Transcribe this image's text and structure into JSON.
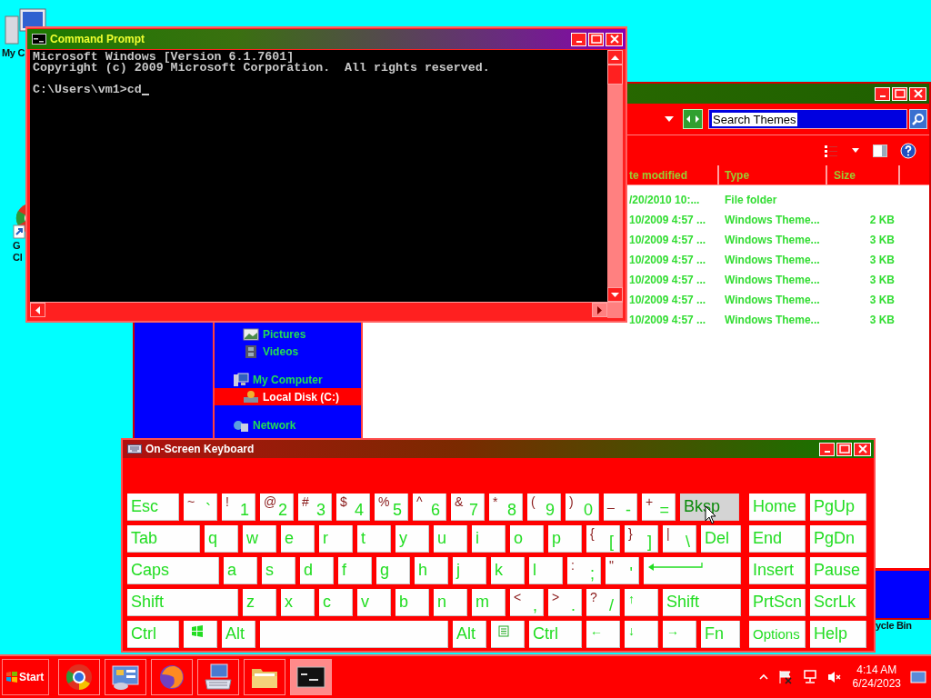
{
  "desktop_icons": [
    {
      "kind": "computer",
      "label_lines": [
        "My C"
      ]
    },
    {
      "kind": "browser",
      "label_lines": [
        "G",
        "Cl"
      ]
    },
    {
      "kind": "recycle_bin",
      "label_lines": [
        "ycle Bin"
      ]
    }
  ],
  "explorer": {
    "search": {
      "value": "Search Themes",
      "text_selected": true
    },
    "columns": [
      "te modified",
      "Type",
      "Size"
    ],
    "rows": [
      {
        "date": "/20/2010 10:...",
        "type": "File folder"
      },
      {
        "date": "10/2009 4:57 ...",
        "type": "Windows Theme...",
        "size": "2 KB"
      },
      {
        "date": "10/2009 4:57 ...",
        "type": "Windows Theme...",
        "size": "3 KB"
      },
      {
        "date": "10/2009 4:57 ...",
        "type": "Windows Theme...",
        "size": "3 KB"
      },
      {
        "date": "10/2009 4:57 ...",
        "type": "Windows Theme...",
        "size": "3 KB"
      },
      {
        "date": "10/2009 4:57 ...",
        "type": "Windows Theme...",
        "size": "3 KB"
      },
      {
        "date": "10/2009 4:57 ...",
        "type": "Windows Theme...",
        "size": "3 KB"
      }
    ],
    "nav": [
      {
        "children": [
          {
            "label": "Pictures",
            "kind": "pictures",
            "selected": false
          },
          {
            "label": "Videos",
            "kind": "videos",
            "selected": false
          }
        ]
      },
      {
        "label": "My Computer",
        "kind": "computer",
        "selected": false,
        "children": [
          {
            "label": "Local Disk (C:)",
            "kind": "disk",
            "selected": true
          }
        ]
      },
      {
        "label": "Network",
        "kind": "network",
        "selected": false
      }
    ]
  },
  "command_prompt": {
    "title": "Command Prompt",
    "lines": [
      "Microsoft Windows [Version 6.1.7601]",
      "Copyright (c) 2009 Microsoft Corporation.  All rights reserved."
    ],
    "prompt": "C:\\Users\\vm1>cd"
  },
  "keyboard": {
    "title": "On-Screen Keyboard",
    "main_rows": [
      [
        {
          "kind": "word",
          "label": "Esc",
          "hovered": false
        },
        {
          "kind": "dual",
          "shift": "~",
          "base": "`",
          "hovered": false
        },
        {
          "kind": "dual",
          "shift": "!",
          "base": "1",
          "hovered": false
        },
        {
          "kind": "dual",
          "shift": "@",
          "base": "2",
          "hovered": false
        },
        {
          "kind": "dual",
          "shift": "#",
          "base": "3",
          "hovered": false
        },
        {
          "kind": "dual",
          "shift": "$",
          "base": "4",
          "hovered": false
        },
        {
          "kind": "dual",
          "shift": "%",
          "base": "5",
          "hovered": false
        },
        {
          "kind": "dual",
          "shift": "^",
          "base": "6",
          "hovered": false
        },
        {
          "kind": "dual",
          "shift": "&",
          "base": "7",
          "hovered": false
        },
        {
          "kind": "dual",
          "shift": "*",
          "base": "8",
          "hovered": false
        },
        {
          "kind": "dual",
          "shift": "(",
          "base": "9",
          "hovered": false
        },
        {
          "kind": "dual",
          "shift": ")",
          "base": "0",
          "hovered": false
        },
        {
          "kind": "dual",
          "shift": "_",
          "base": "-",
          "hovered": false
        },
        {
          "kind": "dual",
          "shift": "+",
          "base": "=",
          "hovered": false
        },
        {
          "kind": "word",
          "label": "Bksp",
          "hovered": true
        }
      ],
      [
        {
          "kind": "word",
          "label": "Tab",
          "hovered": false
        },
        {
          "kind": "word",
          "label": "q",
          "hovered": false
        },
        {
          "kind": "word",
          "label": "w",
          "hovered": false
        },
        {
          "kind": "word",
          "label": "e",
          "hovered": false
        },
        {
          "kind": "word",
          "label": "r",
          "hovered": false
        },
        {
          "kind": "word",
          "label": "t",
          "hovered": false
        },
        {
          "kind": "word",
          "label": "y",
          "hovered": false
        },
        {
          "kind": "word",
          "label": "u",
          "hovered": false
        },
        {
          "kind": "word",
          "label": "i",
          "hovered": false
        },
        {
          "kind": "word",
          "label": "o",
          "hovered": false
        },
        {
          "kind": "word",
          "label": "p",
          "hovered": false
        },
        {
          "kind": "dual",
          "shift": "{",
          "base": "[",
          "hovered": false
        },
        {
          "kind": "dual",
          "shift": "}",
          "base": "]",
          "hovered": false
        },
        {
          "kind": "dual",
          "shift": "|",
          "base": "\\",
          "hovered": false
        },
        {
          "kind": "word",
          "label": "Del",
          "hovered": false
        }
      ],
      [
        {
          "kind": "word",
          "label": "Caps",
          "hovered": false
        },
        {
          "kind": "word",
          "label": "a",
          "hovered": false
        },
        {
          "kind": "word",
          "label": "s",
          "hovered": false
        },
        {
          "kind": "word",
          "label": "d",
          "hovered": false
        },
        {
          "kind": "word",
          "label": "f",
          "hovered": false
        },
        {
          "kind": "word",
          "label": "g",
          "hovered": false
        },
        {
          "kind": "word",
          "label": "h",
          "hovered": false
        },
        {
          "kind": "word",
          "label": "j",
          "hovered": false
        },
        {
          "kind": "word",
          "label": "k",
          "hovered": false
        },
        {
          "kind": "word",
          "label": "l",
          "hovered": false
        },
        {
          "kind": "dual",
          "shift": ":",
          "base": ";",
          "hovered": false
        },
        {
          "kind": "dual",
          "shift": "\"",
          "base": "'",
          "hovered": false
        },
        {
          "kind": "enter",
          "hovered": false
        }
      ],
      [
        {
          "kind": "word",
          "label": "Shift",
          "hovered": false
        },
        {
          "kind": "word",
          "label": "z",
          "hovered": false
        },
        {
          "kind": "word",
          "label": "x",
          "hovered": false
        },
        {
          "kind": "word",
          "label": "c",
          "hovered": false
        },
        {
          "kind": "word",
          "label": "v",
          "hovered": false
        },
        {
          "kind": "word",
          "label": "b",
          "hovered": false
        },
        {
          "kind": "word",
          "label": "n",
          "hovered": false
        },
        {
          "kind": "word",
          "label": "m",
          "hovered": false
        },
        {
          "kind": "dual",
          "shift": "<",
          "base": ",",
          "hovered": false
        },
        {
          "kind": "dual",
          "shift": ">",
          "base": ".",
          "hovered": false
        },
        {
          "kind": "dual",
          "shift": "?",
          "base": "/",
          "hovered": false
        },
        {
          "kind": "arrow",
          "label": "↑",
          "hovered": false
        },
        {
          "kind": "word",
          "label": "Shift",
          "hovered": false
        }
      ],
      [
        {
          "kind": "word",
          "label": "Ctrl",
          "hovered": false
        },
        {
          "kind": "windows",
          "hovered": false
        },
        {
          "kind": "word",
          "label": "Alt",
          "hovered": false
        },
        {
          "kind": "space",
          "hovered": false
        },
        {
          "kind": "word",
          "label": "Alt",
          "hovered": false
        },
        {
          "kind": "menu",
          "hovered": false
        },
        {
          "kind": "word",
          "label": "Ctrl",
          "hovered": false
        },
        {
          "kind": "arrow",
          "label": "←",
          "hovered": false
        },
        {
          "kind": "arrow",
          "label": "↓",
          "hovered": false
        },
        {
          "kind": "arrow",
          "label": "→",
          "hovered": false
        },
        {
          "kind": "word",
          "label": "Fn",
          "hovered": false
        }
      ]
    ],
    "nav_rows": [
      [
        {
          "kind": "word",
          "label": "Home",
          "hovered": false
        },
        {
          "kind": "word",
          "label": "PgUp",
          "hovered": false
        }
      ],
      [
        {
          "kind": "word",
          "label": "End",
          "hovered": false
        },
        {
          "kind": "word",
          "label": "PgDn",
          "hovered": false
        }
      ],
      [
        {
          "kind": "word",
          "label": "Insert",
          "hovered": false
        },
        {
          "kind": "word",
          "label": "Pause",
          "hovered": false
        }
      ],
      [
        {
          "kind": "word",
          "label": "PrtScn",
          "hovered": false
        },
        {
          "kind": "word",
          "label": "ScrLk",
          "hovered": false
        }
      ],
      [
        {
          "kind": "small",
          "label": "Options",
          "hovered": false
        },
        {
          "kind": "word",
          "label": "Help",
          "hovered": false
        }
      ]
    ]
  },
  "taskbar": {
    "start": "Start",
    "items": [
      {
        "kind": "browser",
        "selected": false
      },
      {
        "kind": "control_panel",
        "selected": false
      },
      {
        "kind": "firefox",
        "selected": false
      },
      {
        "kind": "keyboard",
        "selected": false
      },
      {
        "kind": "folder",
        "selected": false
      },
      {
        "kind": "console",
        "selected": true
      }
    ],
    "time": "4:14 AM",
    "date": "6/24/2023"
  }
}
